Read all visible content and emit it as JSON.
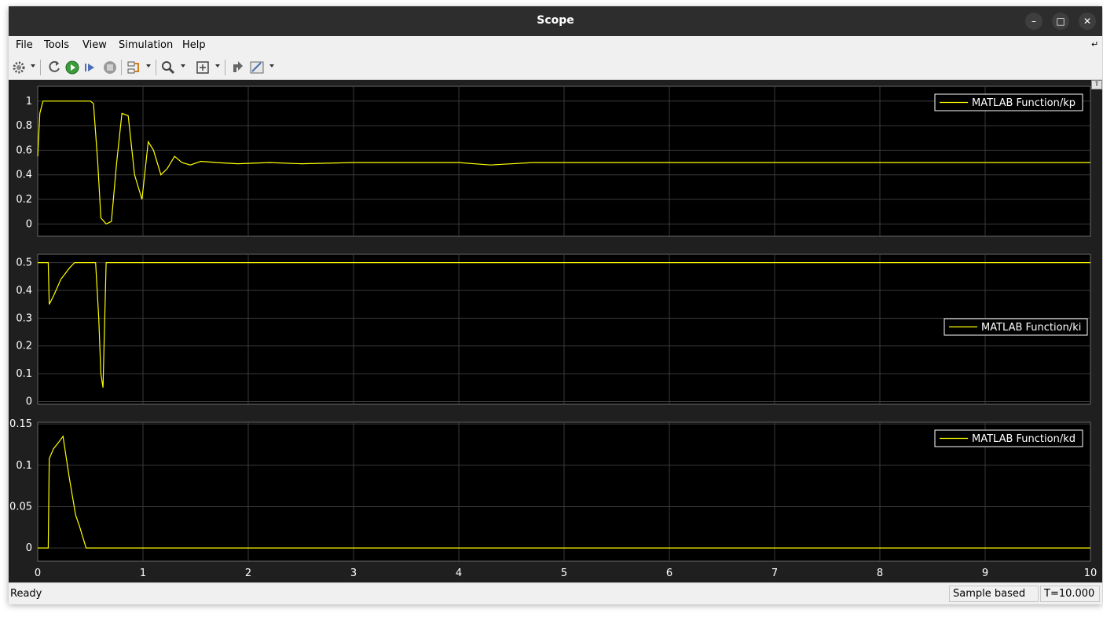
{
  "window": {
    "title": "Scope"
  },
  "menu": {
    "items": [
      "File",
      "Tools",
      "View",
      "Simulation",
      "Help"
    ]
  },
  "status": {
    "ready": "Ready",
    "mode": "Sample based",
    "time": "T=10.000"
  },
  "colors": {
    "plot_bg": "#000000",
    "figure_bg": "#1f1f1f",
    "grid": "#3a3a3a",
    "trace": "#ffff00",
    "text": "#ffffff"
  },
  "toolbar_icons": [
    "settings-icon",
    "restore-icon",
    "run-icon",
    "step-forward-icon",
    "stop-icon",
    "highlight-block-icon",
    "zoom-icon",
    "autoscale-icon",
    "data-cursor-icon",
    "style-icon"
  ],
  "chart_data": [
    {
      "type": "line",
      "legend": "MATLAB Function/kp",
      "legend_loc": "top-right",
      "xlim": [
        0,
        10
      ],
      "ylim": [
        -0.1,
        1.12
      ],
      "yticks": [
        0,
        0.2,
        0.4,
        0.6,
        0.8,
        1
      ],
      "yticklabels": [
        "0",
        "0.2",
        "0.4",
        "0.6",
        "0.8",
        "1"
      ],
      "grid": true,
      "x": [
        0,
        0.02,
        0.05,
        0.1,
        0.2,
        0.3,
        0.4,
        0.5,
        0.53,
        0.57,
        0.6,
        0.65,
        0.7,
        0.75,
        0.8,
        0.86,
        0.92,
        0.99,
        1.05,
        1.1,
        1.17,
        1.23,
        1.3,
        1.37,
        1.45,
        1.55,
        1.7,
        1.9,
        2.2,
        2.5,
        3,
        3.5,
        4,
        4.3,
        4.7,
        5,
        5.5,
        6,
        6.5,
        7,
        7.5,
        8,
        8.5,
        9,
        9.5,
        10
      ],
      "y": [
        0.55,
        0.9,
        1,
        1,
        1,
        1,
        1,
        1,
        0.98,
        0.5,
        0.05,
        0,
        0.02,
        0.5,
        0.9,
        0.88,
        0.4,
        0.2,
        0.67,
        0.6,
        0.4,
        0.45,
        0.55,
        0.5,
        0.48,
        0.51,
        0.5,
        0.49,
        0.5,
        0.49,
        0.5,
        0.5,
        0.5,
        0.48,
        0.5,
        0.5,
        0.5,
        0.5,
        0.5,
        0.5,
        0.5,
        0.5,
        0.5,
        0.5,
        0.5,
        0.5
      ]
    },
    {
      "type": "line",
      "legend": "MATLAB Function/ki",
      "legend_loc": "right",
      "xlim": [
        0,
        10
      ],
      "ylim": [
        -0.01,
        0.53
      ],
      "yticks": [
        0,
        0.1,
        0.2,
        0.3,
        0.4,
        0.5
      ],
      "yticklabels": [
        "0",
        "0.1",
        "0.2",
        "0.3",
        "0.4",
        "0.5"
      ],
      "grid": true,
      "x": [
        0,
        0.1,
        0.11,
        0.15,
        0.22,
        0.3,
        0.35,
        0.45,
        0.55,
        0.58,
        0.6,
        0.62,
        0.65,
        0.7,
        1,
        10
      ],
      "y": [
        0.5,
        0.5,
        0.35,
        0.38,
        0.44,
        0.48,
        0.5,
        0.5,
        0.5,
        0.3,
        0.1,
        0.05,
        0.5,
        0.5,
        0.5,
        0.5
      ]
    },
    {
      "type": "line",
      "legend": "MATLAB Function/kd",
      "legend_loc": "top-right",
      "xlim": [
        0,
        10
      ],
      "ylim": [
        -0.016,
        0.152
      ],
      "yticks": [
        0,
        0.05,
        0.1,
        0.15
      ],
      "yticklabels": [
        "0",
        "0.05",
        "0.1",
        "0.15"
      ],
      "grid": true,
      "xticks": [
        0,
        1,
        2,
        3,
        4,
        5,
        6,
        7,
        8,
        9,
        10
      ],
      "xticklabels": [
        "0",
        "1",
        "2",
        "3",
        "4",
        "5",
        "6",
        "7",
        "8",
        "9",
        "10"
      ],
      "x": [
        0,
        0.1,
        0.11,
        0.15,
        0.2,
        0.24,
        0.27,
        0.3,
        0.36,
        0.4,
        0.46,
        0.5,
        1,
        10
      ],
      "y": [
        0,
        0,
        0.108,
        0.12,
        0.128,
        0.135,
        0.11,
        0.085,
        0.04,
        0.025,
        0,
        0,
        0,
        0
      ]
    }
  ]
}
